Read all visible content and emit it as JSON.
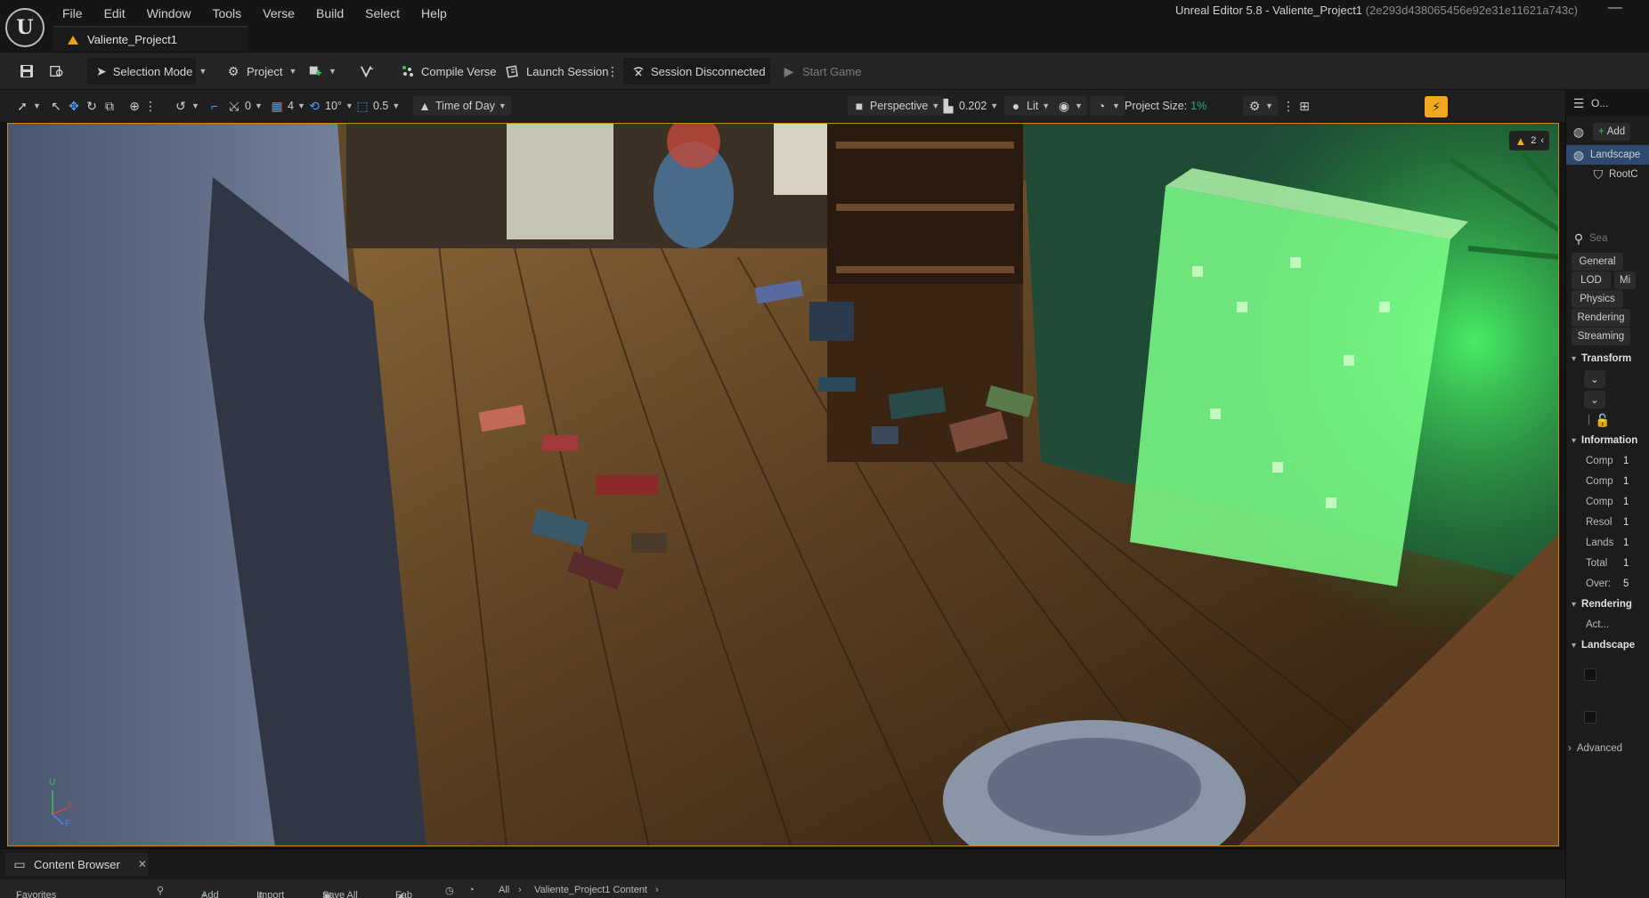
{
  "app": {
    "window_title": "Unreal Editor 5.8 - Valiente_Project1",
    "window_hash": "(2e293d438065456e92e31e11621a743c)",
    "project_tab": "Valiente_Project1",
    "logo_text": "U",
    "minimize_glyph": "—"
  },
  "menu": [
    "File",
    "Edit",
    "Window",
    "Tools",
    "Verse",
    "Build",
    "Select",
    "Help"
  ],
  "toolbar": {
    "selection_mode": "Selection Mode",
    "project": "Project",
    "compile_verse": "Compile Verse",
    "launch_session": "Launch Session",
    "session_status": "Session Disconnected",
    "start_game": "Start Game"
  },
  "viewport_toolbar": {
    "snap_rotation_value": "0",
    "grid_value": "4",
    "angle_value": "10°",
    "scale_value": "0.5",
    "time_of_day": "Time of Day",
    "perspective": "Perspective",
    "camera_speed": "0.202",
    "lit": "Lit",
    "project_size_label": "Project Size:",
    "project_size_value": "1%"
  },
  "viewport": {
    "warning_count": "2",
    "axis_up": "U",
    "axis_left": "L",
    "axis_forward": "F"
  },
  "right_panel": {
    "tab_label": "O...",
    "add_label": "Add",
    "outliner_items": [
      "Landscape",
      "RootC"
    ],
    "search_placeholder": "Sea",
    "filter_buttons": [
      "General",
      "LOD",
      "Mi",
      "Physics",
      "Rendering",
      "Streaming"
    ],
    "sections": {
      "transform": "Transform",
      "information": "Information",
      "rendering": "Rendering",
      "landscape": "Landscape",
      "advanced": "Advanced"
    },
    "info_rows": [
      {
        "label": "Comp",
        "value": "1"
      },
      {
        "label": "Comp",
        "value": "1"
      },
      {
        "label": "Comp",
        "value": "1"
      },
      {
        "label": "Resol",
        "value": "1"
      },
      {
        "label": "Lands",
        "value": "1"
      },
      {
        "label": "Total",
        "value": "1"
      },
      {
        "label": "Over:",
        "value": "5"
      }
    ],
    "rendering_row": "Act..."
  },
  "content_browser": {
    "tab_label": "Content Browser",
    "favorites": "Favorites",
    "add": "Add",
    "import": "Import",
    "save_all": "Save All",
    "fab": "Fab",
    "path_all": "All",
    "path_project": "Valiente_Project1 Content"
  }
}
